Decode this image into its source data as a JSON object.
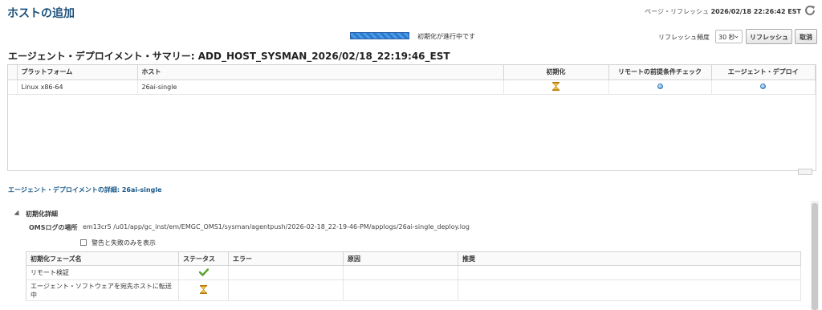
{
  "header": {
    "title": "ホストの追加",
    "page_refresh_label": "ページ・リフレッシュ",
    "page_refresh_time": "2026/02/18 22:26:42 EST"
  },
  "progress": {
    "text": "初期化が進行中です"
  },
  "refresh": {
    "frequency_label": "リフレッシュ頻度",
    "frequency_value": "30 秒",
    "refresh_button": "リフレッシュ",
    "cancel_button": "取消"
  },
  "summary": {
    "title": "エージェント・デプロイメント・サマリー: ADD_HOST_SYSMAN_2026/02/18_22:19:46_EST",
    "columns": [
      "プラットフォーム",
      "ホスト",
      "初期化",
      "リモートの前提条件チェック",
      "エージェント・デプロイ"
    ],
    "rows": [
      {
        "platform": "Linux x86-64",
        "host": "26ai-single",
        "init": "hourglass-icon",
        "prereq": "pending-dot-icon",
        "deploy": "pending-dot-icon"
      }
    ]
  },
  "details": {
    "link": "エージェント・デプロイメントの詳細: 26ai-single",
    "section_title": "初期化詳細",
    "oms_log_label": "OMSログの場所",
    "oms_log_value": "em13cr5 /u01/app/gc_inst/em/EMGC_OMS1/sysman/agentpush/2026-02-18_22-19-46-PM/applogs/26ai-single_deploy.log",
    "filter_label": "警告と失敗のみを表示",
    "columns": [
      "初期化フェーズ名",
      "ステータス",
      "エラー",
      "原因",
      "推奨"
    ],
    "rows": [
      {
        "phase": "リモート検証",
        "status": "checkmark-icon"
      },
      {
        "phase": "エージェント・ソフトウェアを宛先ホストに転送中",
        "status": "hourglass-icon"
      }
    ]
  },
  "colors": {
    "title": "#1a4f7a",
    "progress": "#2d7bd0",
    "check": "#5aa02c",
    "hourglass": "#e2a21b"
  }
}
